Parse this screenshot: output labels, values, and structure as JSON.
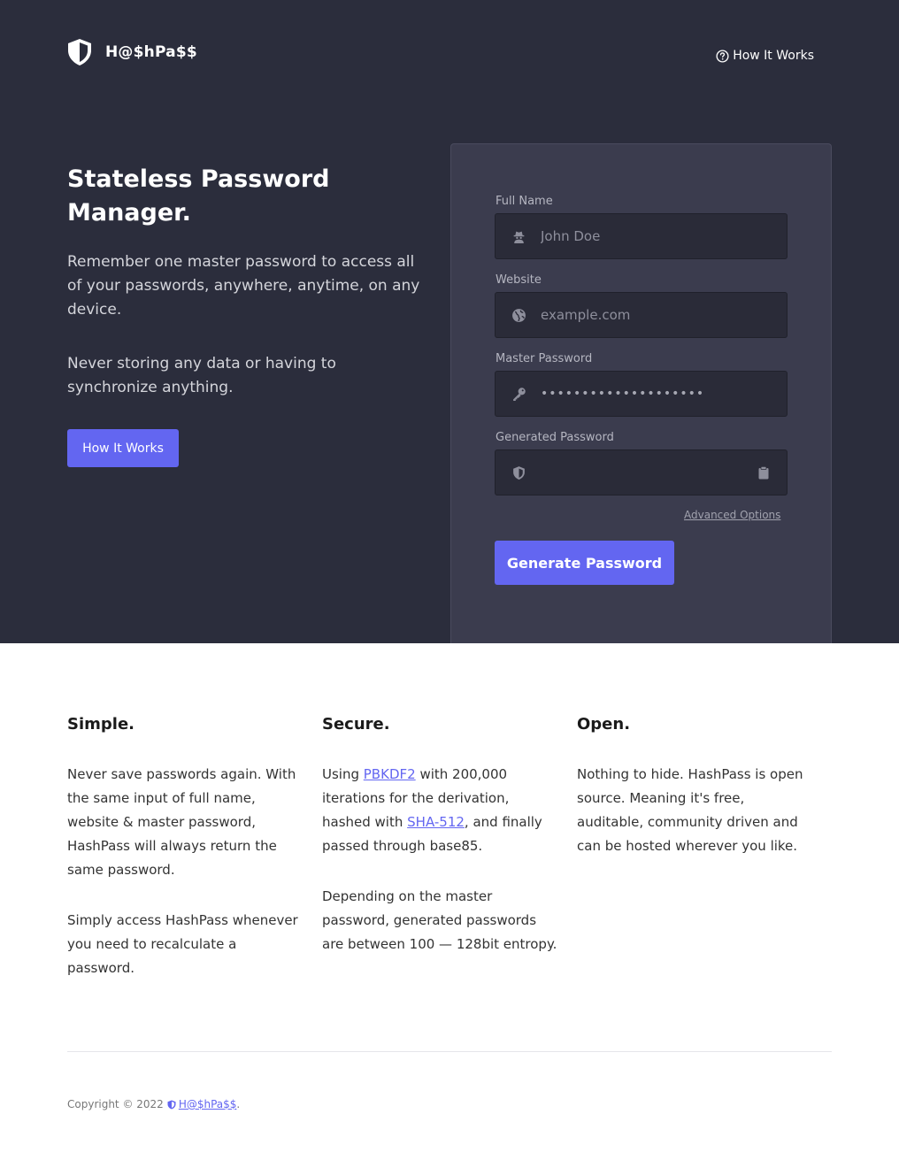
{
  "header": {
    "brand": "H@$hPa$$",
    "nav_link": "How It Works"
  },
  "hero": {
    "title": "Stateless Password Manager.",
    "paragraph1": "Remember one master password to access all of your passwords, anywhere, anytime, on any device.",
    "paragraph2": "Never storing any data or having to synchronize anything.",
    "cta": "How It Works"
  },
  "form": {
    "full_name": {
      "label": "Full Name",
      "placeholder": "John Doe",
      "icon": "user-secret-icon"
    },
    "website": {
      "label": "Website",
      "placeholder": "example.com",
      "icon": "globe-icon"
    },
    "master_password": {
      "label": "Master Password",
      "value": "••••••••••••••••••••",
      "icon": "key-icon"
    },
    "generated_password": {
      "label": "Generated Password",
      "value": "",
      "icon": "shield-icon"
    },
    "advanced_options": "Advanced Options",
    "generate_button": "Generate Password"
  },
  "features": {
    "simple": {
      "title": "Simple.",
      "p1": "Never save passwords again. With the same input of full name, website & master password, HashPass will always return the same password.",
      "p2": "Simply access HashPass whenever you need to recalculate a password."
    },
    "secure": {
      "title": "Secure.",
      "p1_before": "Using ",
      "p1_link1": "PBKDF2",
      "p1_mid": " with 200,000 iterations for the derivation, hashed with ",
      "p1_link2": "SHA-512",
      "p1_after": ", and finally passed through base85.",
      "p2": "Depending on the master password, generated passwords are between 100 — 128bit entropy."
    },
    "open": {
      "title": "Open.",
      "p1": "Nothing to hide. HashPass is open source. Meaning it's free, auditable, community driven and can be hosted wherever you like."
    }
  },
  "footer": {
    "copyright": "Copyright © 2022",
    "brand_link": "H@$hPa$$",
    "trailing": "."
  },
  "colors": {
    "hero_bg": "#2b2d3c",
    "card_bg": "#3b3c4e",
    "input_bg": "#2a2b38",
    "accent": "#6366f1"
  }
}
